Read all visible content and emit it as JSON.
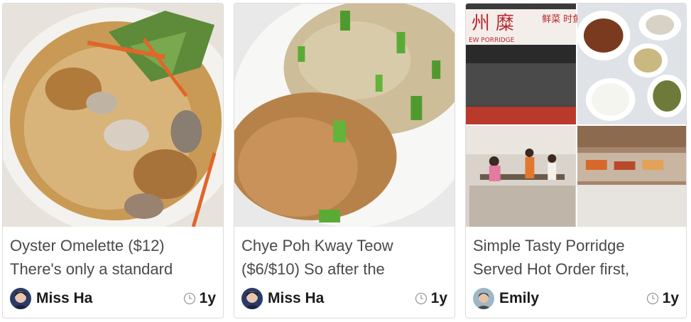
{
  "cards": [
    {
      "photo_icon": "oyster-omelette-photo",
      "title_line": "Oyster Omelette ($12)",
      "excerpt_line": "There's only a standard",
      "author": "Miss Ha",
      "age": "1y",
      "clock_icon": "clock-icon"
    },
    {
      "photo_icon": "chye-poh-kway-teow-photo",
      "title_line": "Chye Poh Kway Teow",
      "excerpt_line": "($6/$10) So after the",
      "author": "Miss Ha",
      "age": "1y",
      "clock_icon": "clock-icon"
    },
    {
      "photo_icon": "porridge-shop-collage-photo",
      "sign_text": "州 糜",
      "sign_sub": "EW PORRIDGE",
      "sign_side": "鲜菜 时鱼",
      "title_line": "Simple Tasty Porridge",
      "excerpt_line": "Served Hot Order first,",
      "author": "Emily",
      "age": "1y",
      "clock_icon": "clock-icon"
    }
  ],
  "colors": {
    "text": "#4a4a4a",
    "author": "#1b1b1b",
    "border": "#dcdcdc"
  }
}
